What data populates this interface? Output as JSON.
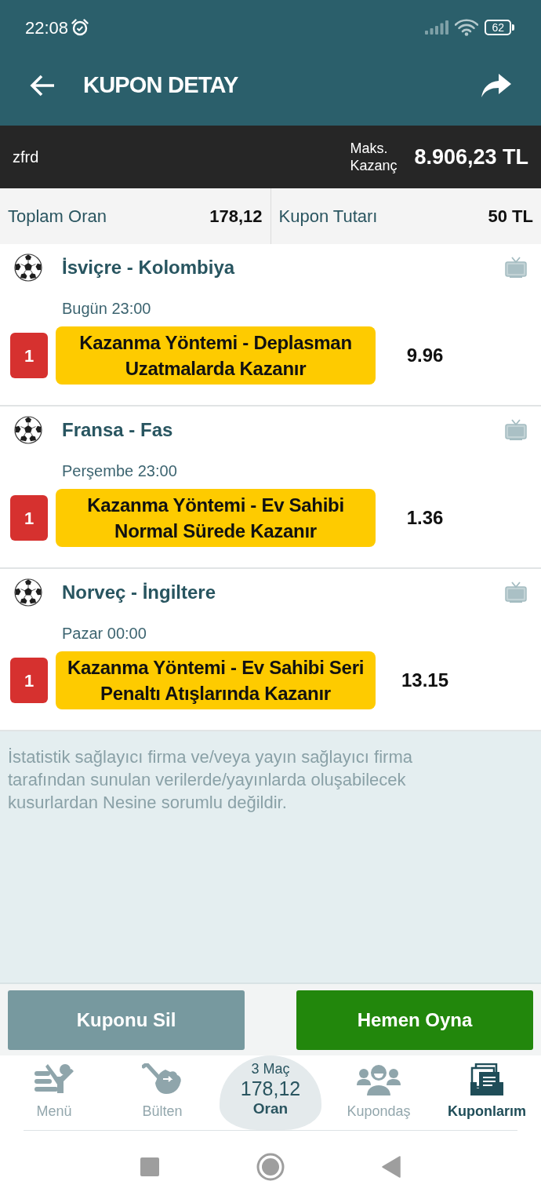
{
  "status_bar": {
    "time": "22:08",
    "battery": "62"
  },
  "header": {
    "title": "KUPON DETAY"
  },
  "coupon_bar": {
    "name": "zfrd",
    "max_win_label": "Maks. Kazanç",
    "max_win": "8.906,23 TL"
  },
  "summary": [
    {
      "label": "Toplam Oran",
      "value": "178,12"
    },
    {
      "label": "Kupon Tutarı",
      "value": "50 TL"
    }
  ],
  "matches": [
    {
      "teams": "İsviçre - Kolombiya",
      "time": "Bugün 23:00",
      "pick": "1",
      "selection": "Kazanma Yöntemi - Deplasman Uzatmalarda Kazanır",
      "odds": "9.96"
    },
    {
      "teams": "Fransa - Fas",
      "time": "Perşembe 23:00",
      "pick": "1",
      "selection": "Kazanma Yöntemi - Ev Sahibi Normal Sürede Kazanır",
      "odds": "1.36"
    },
    {
      "teams": "Norveç - İngiltere",
      "time": "Pazar 00:00",
      "pick": "1",
      "selection": "Kazanma Yöntemi - Ev Sahibi Seri Penaltı Atışlarında Kazanır",
      "odds": "13.15"
    }
  ],
  "disclaimer": "İstatistik sağlayıcı firma ve/veya yayın sağlayıcı firma tarafından sunulan verilerde/yayınlarda oluşabilecek kusurlardan Nesine sorumlu değildir.",
  "actions": [
    {
      "label": "Kuponu Sil",
      "kind": "delete"
    },
    {
      "label": "Hemen Oyna",
      "kind": "play"
    }
  ],
  "bottom_nav": [
    {
      "kind": "menu",
      "label": "Menü",
      "selected": false
    },
    {
      "kind": "bulletin",
      "label": "Bülten",
      "selected": false
    },
    {
      "kind": "bubble",
      "count": "3 Maç",
      "odds": "178,12",
      "label": "Oran",
      "selected": false
    },
    {
      "kind": "community",
      "label": "Kupondaş",
      "selected": false
    },
    {
      "kind": "coupons",
      "label": "Kuponlarım",
      "selected": true
    }
  ]
}
